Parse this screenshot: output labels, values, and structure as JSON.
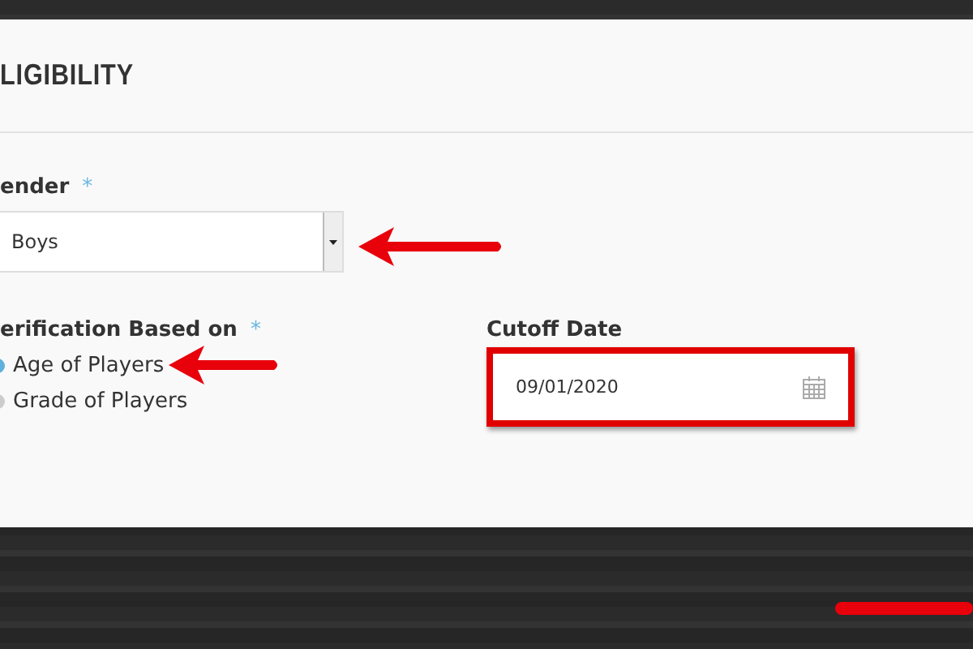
{
  "section": {
    "title": "LIGIBILITY"
  },
  "gender": {
    "label": "ender",
    "required_mark": "*",
    "value": "Boys"
  },
  "verification": {
    "label": "erification Based on",
    "required_mark": "*",
    "options": [
      {
        "label": "Age of Players",
        "selected": true
      },
      {
        "label": "Grade of Players",
        "selected": false
      }
    ]
  },
  "cutoff": {
    "label": "Cutoff Date",
    "value": "09/01/2020"
  }
}
